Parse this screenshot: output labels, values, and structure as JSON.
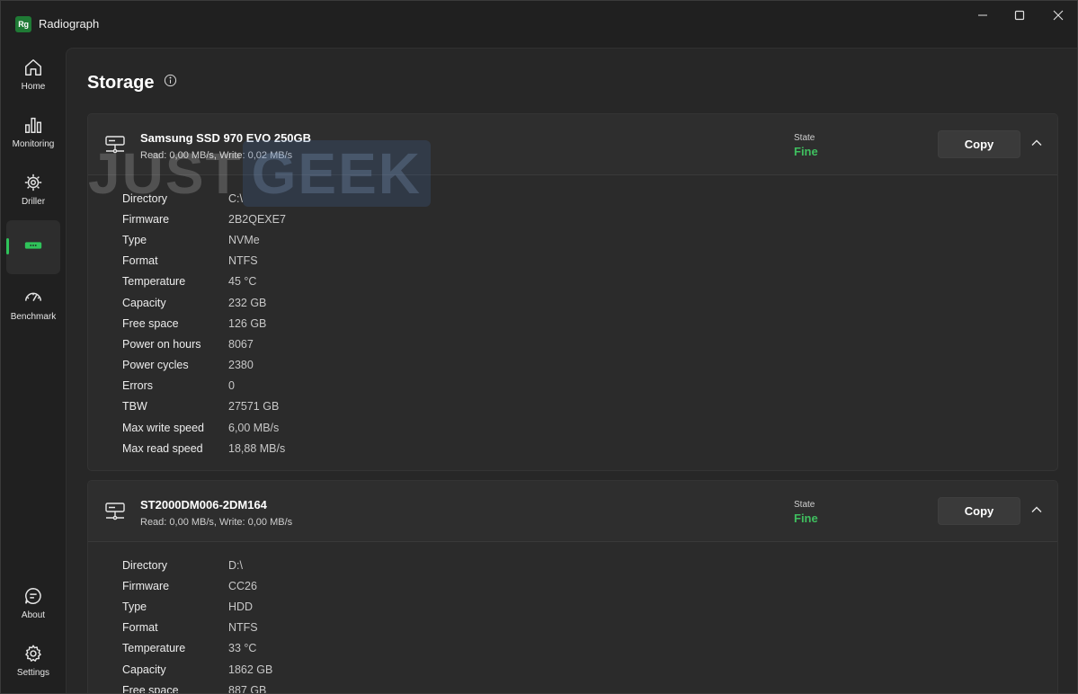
{
  "app": {
    "logo_text": "Rg",
    "title": "Radiograph"
  },
  "window_controls": {
    "minimize": "minimize",
    "maximize": "maximize",
    "close": "close"
  },
  "sidebar": {
    "items": [
      {
        "label": "Home",
        "icon": "home-icon"
      },
      {
        "label": "Monitoring",
        "icon": "bar-chart-icon"
      },
      {
        "label": "Driller",
        "icon": "driller-icon"
      },
      {
        "label": "",
        "icon": "storage-icon",
        "active": true
      },
      {
        "label": "Benchmark",
        "icon": "speedometer-icon"
      },
      {
        "label": "About",
        "icon": "chat-icon"
      },
      {
        "label": "Settings",
        "icon": "gear-icon"
      }
    ]
  },
  "page": {
    "title": "Storage"
  },
  "watermark": {
    "part1": "JUST",
    "part2": "GEEK"
  },
  "drives": [
    {
      "name": "Samsung SSD 970 EVO 250GB",
      "rw": "Read: 0,00 MB/s, Write: 0,02 MB/s",
      "state_label": "State",
      "state": "Fine",
      "copy_label": "Copy",
      "props": [
        {
          "k": "Directory",
          "v": "C:\\"
        },
        {
          "k": "Firmware",
          "v": "2B2QEXE7"
        },
        {
          "k": "Type",
          "v": "NVMe"
        },
        {
          "k": "Format",
          "v": "NTFS"
        },
        {
          "k": "Temperature",
          "v": "45 °C"
        },
        {
          "k": "Capacity",
          "v": "232 GB"
        },
        {
          "k": "Free space",
          "v": "126 GB"
        },
        {
          "k": "Power on hours",
          "v": "8067"
        },
        {
          "k": "Power cycles",
          "v": "2380"
        },
        {
          "k": "Errors",
          "v": "0"
        },
        {
          "k": "TBW",
          "v": "27571 GB"
        },
        {
          "k": "Max write speed",
          "v": "6,00 MB/s"
        },
        {
          "k": "Max read speed",
          "v": "18,88 MB/s"
        }
      ]
    },
    {
      "name": "ST2000DM006-2DM164",
      "rw": "Read: 0,00 MB/s, Write: 0,00 MB/s",
      "state_label": "State",
      "state": "Fine",
      "copy_label": "Copy",
      "props": [
        {
          "k": "Directory",
          "v": "D:\\"
        },
        {
          "k": "Firmware",
          "v": "CC26"
        },
        {
          "k": "Type",
          "v": "HDD"
        },
        {
          "k": "Format",
          "v": "NTFS"
        },
        {
          "k": "Temperature",
          "v": "33 °C"
        },
        {
          "k": "Capacity",
          "v": "1862 GB"
        },
        {
          "k": "Free space",
          "v": "887 GB"
        }
      ]
    }
  ]
}
